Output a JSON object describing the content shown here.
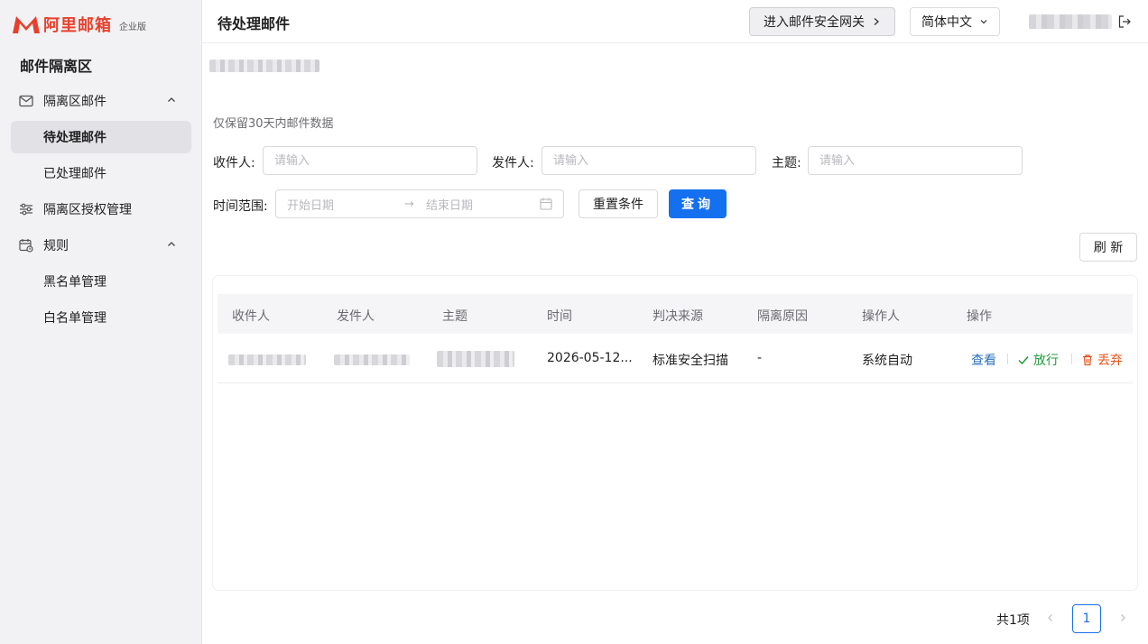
{
  "brand": {
    "name": "阿里邮箱",
    "edition": "企业版",
    "color": "#e8402c"
  },
  "sidebar": {
    "section_title": "邮件隔离区",
    "items": [
      {
        "label": "隔离区邮件",
        "icon": "mail-icon"
      },
      {
        "label": "待处理邮件"
      },
      {
        "label": "已处理邮件"
      },
      {
        "label": "隔离区授权管理",
        "icon": "sliders-icon"
      },
      {
        "label": "规则",
        "icon": "rule-calendar-icon"
      },
      {
        "label": "黑名单管理"
      },
      {
        "label": "白名单管理"
      }
    ]
  },
  "header": {
    "title": "待处理邮件",
    "gateway_button": "进入邮件安全网关",
    "language": "简体中文"
  },
  "notice": "仅保留30天内邮件数据",
  "filters": {
    "recipient_label": "收件人:",
    "sender_label": "发件人:",
    "subject_label": "主题:",
    "placeholder": "请输入",
    "time_label": "时间范围:",
    "start_placeholder": "开始日期",
    "end_placeholder": "结束日期",
    "reset_button": "重置条件",
    "search_button": "查询"
  },
  "refresh_button": "刷 新",
  "table": {
    "columns": [
      "收件人",
      "发件人",
      "主题",
      "时间",
      "判决来源",
      "隔离原因",
      "操作人",
      "操作"
    ],
    "rows": [
      {
        "time": "2026-05-12...",
        "source": "标准安全扫描",
        "reason": "-",
        "operator": "系统自动"
      }
    ],
    "actions": {
      "view": "查看",
      "release": "放行",
      "discard": "丢弃"
    }
  },
  "colors": {
    "primary": "#1570ef",
    "success": "#1f9d3a",
    "danger": "#e5531a",
    "view": "#2b6fb8"
  },
  "pagination": {
    "total": "共1项",
    "current": "1"
  }
}
